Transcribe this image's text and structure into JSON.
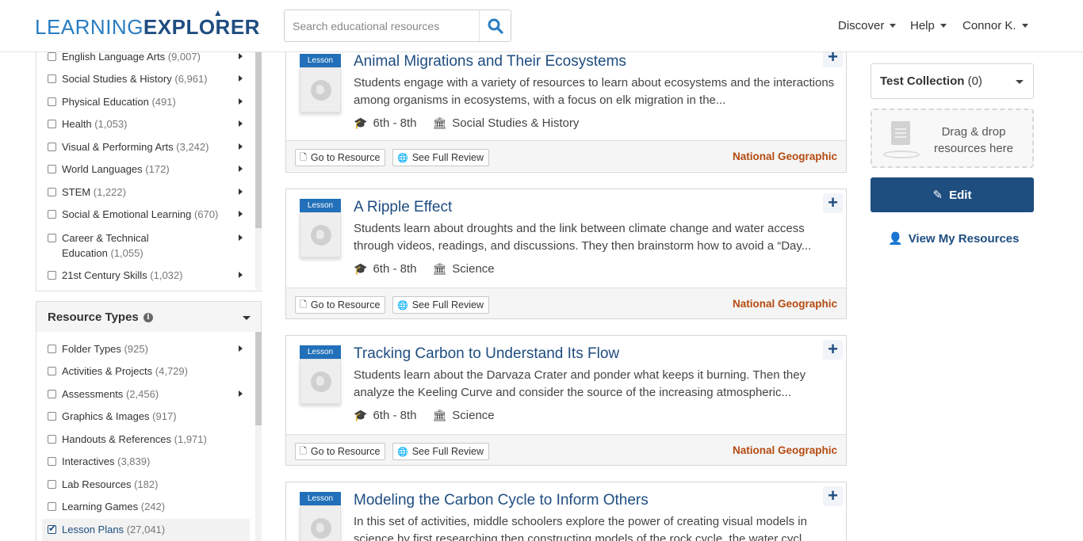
{
  "header": {
    "logo_part1": "LEARNING ",
    "logo_part2": "EXPLORER",
    "search_placeholder": "Search educational resources",
    "nav": [
      {
        "label": "Discover"
      },
      {
        "label": "Help"
      },
      {
        "label": "Connor K."
      }
    ]
  },
  "subjects": {
    "items": [
      {
        "label": "English Language Arts",
        "count": "(9,007)"
      },
      {
        "label": "Social Studies & History",
        "count": "(6,961)"
      },
      {
        "label": "Physical Education",
        "count": "(491)"
      },
      {
        "label": "Health",
        "count": "(1,053)"
      },
      {
        "label": "Visual & Performing Arts",
        "count": "(3,242)"
      },
      {
        "label": "World Languages",
        "count": "(172)"
      },
      {
        "label": "STEM",
        "count": "(1,222)"
      },
      {
        "label": "Social & Emotional Learning",
        "count": "(670)"
      },
      {
        "label": "Career & Technical",
        "label2": "Education",
        "count": "(1,055)"
      },
      {
        "label": "21st Century Skills",
        "count": "(1,032)"
      }
    ]
  },
  "resource_types": {
    "title": "Resource Types",
    "items": [
      {
        "label": "Folder Types",
        "count": "(925)"
      },
      {
        "label": "Activities & Projects",
        "count": "(4,729)"
      },
      {
        "label": "Assessments",
        "count": "(2,456)"
      },
      {
        "label": "Graphics & Images",
        "count": "(917)"
      },
      {
        "label": "Handouts & References",
        "count": "(1,971)"
      },
      {
        "label": "Interactives",
        "count": "(3,839)"
      },
      {
        "label": "Lab Resources",
        "count": "(182)"
      },
      {
        "label": "Learning Games",
        "count": "(242)"
      },
      {
        "label": "Lesson Plans",
        "count": "(27,041)",
        "checked": true
      }
    ]
  },
  "cards": [
    {
      "badge": "Lesson",
      "title": "Animal Migrations and Their Ecosystems",
      "description": "Students engage with a variety of resources to learn about ecosystems and the interactions among organisms in ecosystems, with a focus on elk migration in the...",
      "grades": "6th - 8th",
      "subject": "Social Studies & History",
      "go_label": "Go to Resource",
      "review_label": "See Full Review",
      "publisher": "National Geographic"
    },
    {
      "badge": "Lesson",
      "title": "A Ripple Effect",
      "description": "Students learn about droughts and the link between climate change and water access through videos, readings, and discussions. They then brainstorm how to avoid a “Day...",
      "grades": "6th - 8th",
      "subject": "Science",
      "go_label": "Go to Resource",
      "review_label": "See Full Review",
      "publisher": "National Geographic"
    },
    {
      "badge": "Lesson",
      "title": "Tracking Carbon to Understand Its Flow",
      "description": "Students learn about the Darvaza Crater and ponder what keeps it burning. Then they analyze the Keeling Curve and consider the source of the increasing atmospheric...",
      "grades": "6th - 8th",
      "subject": "Science",
      "go_label": "Go to Resource",
      "review_label": "See Full Review",
      "publisher": "National Geographic"
    },
    {
      "badge": "Lesson",
      "title": "Modeling the Carbon Cycle to Inform Others",
      "description": "In this set of activities, middle schoolers explore the power of creating visual models in science by first researching then constructing models of the rock cycle, the water cycl..."
    }
  ],
  "right": {
    "collection_name": "Test Collection",
    "collection_count": "(0)",
    "dropzone_text": "Drag & drop resources here",
    "edit_label": "Edit",
    "view_label": "View My Resources"
  },
  "colors": {
    "brand_dark": "#1e4d80",
    "brand_light": "#2a7dc1",
    "badge_blue": "#2170b9",
    "publisher": "#b54b10"
  },
  "icons": {
    "search": "magnifier-icon",
    "grades": "graduation-cap-icon",
    "subject": "institution-icon",
    "go": "document-icon",
    "review": "globe-icon",
    "add": "plus-icon",
    "edit": "edit-icon",
    "user": "user-icon"
  }
}
